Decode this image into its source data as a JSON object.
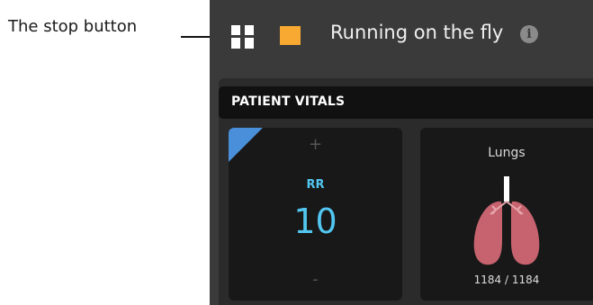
{
  "callout": {
    "text": "The stop button"
  },
  "topbar": {
    "title": "Running on the fly",
    "info_glyph": "i"
  },
  "panel": {
    "header": "PATIENT VITALS"
  },
  "cards": {
    "rr": {
      "label": "RR",
      "value": "10",
      "plus": "+",
      "minus": "-"
    },
    "lungs": {
      "label": "Lungs",
      "value": "1184 / 1184"
    }
  },
  "colors": {
    "stop": "#f7a932",
    "rr_accent": "#52c6f0",
    "corner_flag": "#4a8fd9",
    "lungs": "#c7636e"
  },
  "icons": [
    "pause-icon",
    "stop-icon",
    "info-icon",
    "lungs-icon"
  ]
}
